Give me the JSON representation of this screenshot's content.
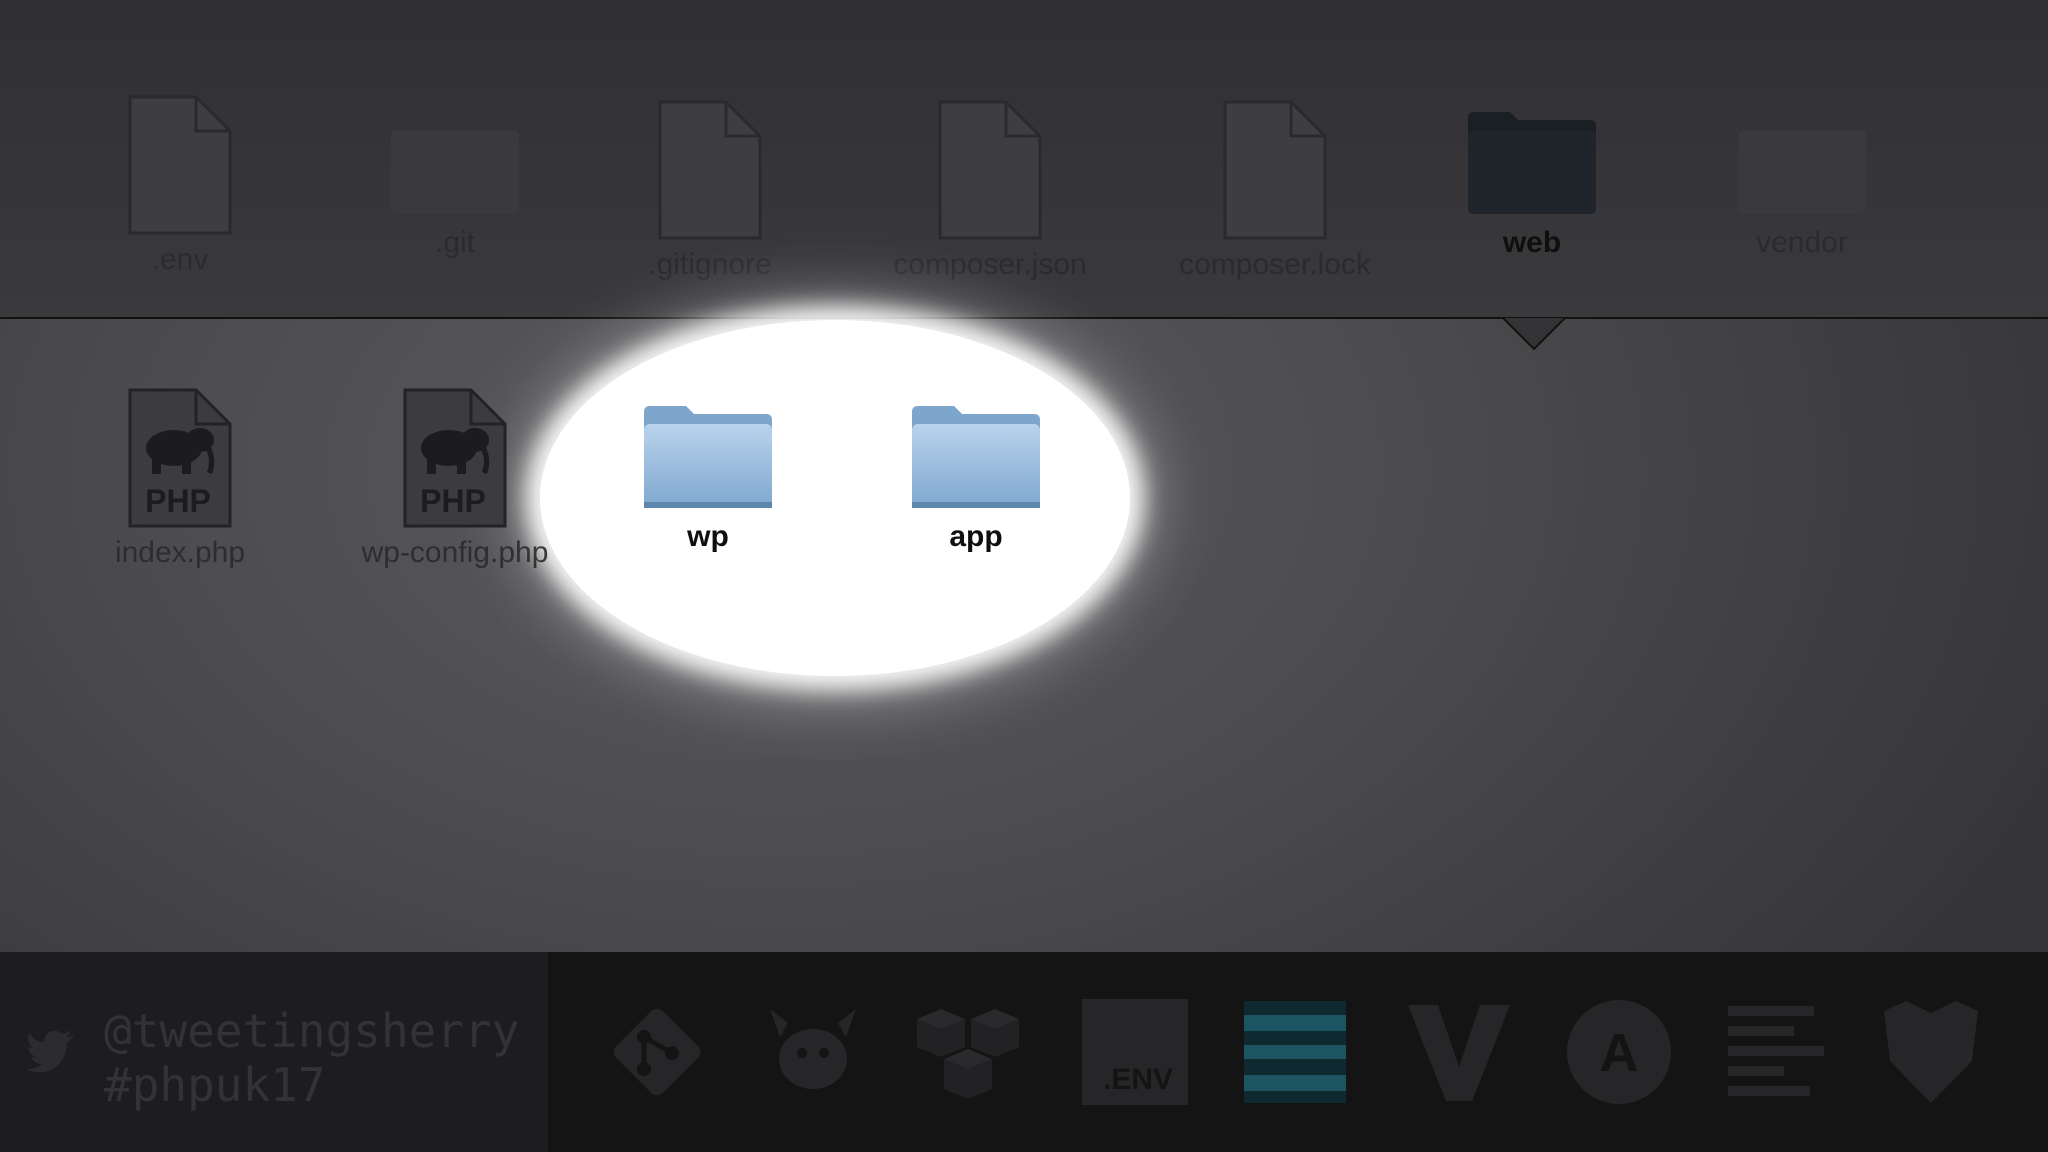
{
  "top_row": {
    "items": [
      {
        "name": ".env",
        "type": "file",
        "selected": false
      },
      {
        "name": ".git",
        "type": "folder",
        "selected": false
      },
      {
        "name": ".gitignore",
        "type": "file",
        "selected": false
      },
      {
        "name": "composer.json",
        "type": "file",
        "selected": false
      },
      {
        "name": "composer.lock",
        "type": "file",
        "selected": false
      },
      {
        "name": "web",
        "type": "folder",
        "selected": true
      },
      {
        "name": "vendor",
        "type": "folder",
        "selected": false
      }
    ]
  },
  "web_contents": {
    "items": [
      {
        "name": "index.php",
        "type": "php-file",
        "badge": "PHP",
        "highlighted": false
      },
      {
        "name": "wp-config.php",
        "type": "php-file",
        "badge": "PHP",
        "highlighted": false
      },
      {
        "name": "wp",
        "type": "folder",
        "highlighted": true
      },
      {
        "name": "app",
        "type": "folder",
        "highlighted": true
      }
    ]
  },
  "footer": {
    "twitter_handle": "@tweetingsherry",
    "hashtag": "#phpuk17",
    "tool_icons": [
      "git-icon",
      "crab-mascot-icon",
      "cubes-icon",
      "env-icon",
      "stripes-logo-icon",
      "v-logo-icon",
      "ansible-icon",
      "lines-logo-icon",
      "shield-icon"
    ],
    "env_icon_text": ".ENV",
    "ansible_icon_letter": "A"
  },
  "colors": {
    "folder_blue": "#8fb4d9",
    "selected_folder": "#20252b",
    "spotlight": "#ffffff",
    "footer_bg": "#141415"
  }
}
